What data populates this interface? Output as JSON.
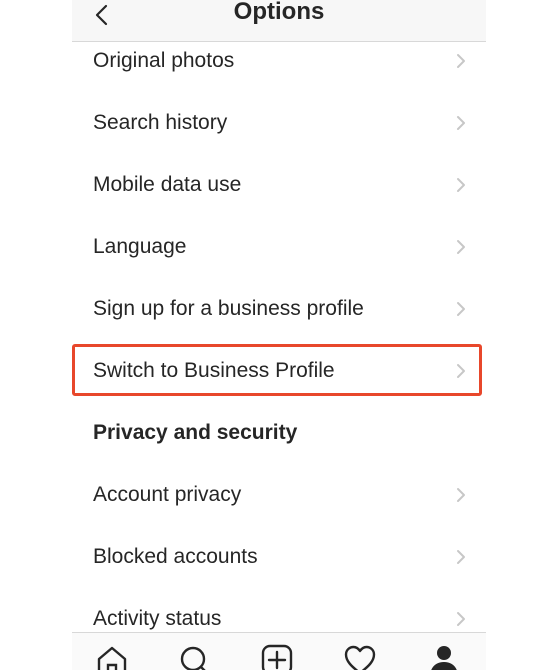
{
  "header": {
    "title": "Options",
    "back_icon": "chevron-left-icon"
  },
  "rows": {
    "original_photos": "Original photos",
    "search_history": "Search history",
    "mobile_data_use": "Mobile data use",
    "language": "Language",
    "sign_up_business": "Sign up for a business profile",
    "switch_business": "Switch to Business Profile",
    "account_privacy": "Account privacy",
    "blocked_accounts": "Blocked accounts",
    "activity_status": "Activity status"
  },
  "section": {
    "privacy_security": "Privacy and security"
  },
  "highlight_color": "#e8472b",
  "tabbar": {
    "icons": [
      "home-icon",
      "search-icon",
      "new-post-icon",
      "activity-heart-icon",
      "profile-icon"
    ]
  }
}
